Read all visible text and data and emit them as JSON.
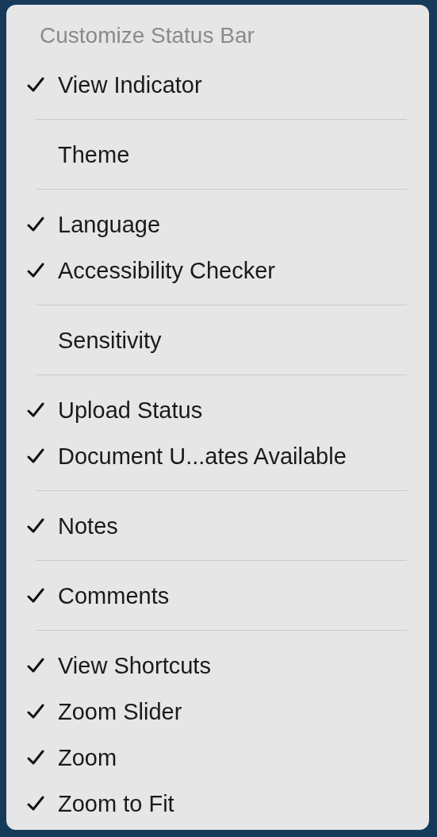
{
  "menu": {
    "title": "Customize Status Bar",
    "groups": [
      [
        {
          "label": "View Indicator",
          "checked": true
        }
      ],
      [
        {
          "label": "Theme",
          "checked": false
        }
      ],
      [
        {
          "label": "Language",
          "checked": true
        },
        {
          "label": "Accessibility Checker",
          "checked": true
        }
      ],
      [
        {
          "label": "Sensitivity",
          "checked": false
        }
      ],
      [
        {
          "label": "Upload Status",
          "checked": true
        },
        {
          "label": "Document U...ates Available",
          "checked": true
        }
      ],
      [
        {
          "label": "Notes",
          "checked": true
        }
      ],
      [
        {
          "label": "Comments",
          "checked": true
        }
      ],
      [
        {
          "label": "View Shortcuts",
          "checked": true
        },
        {
          "label": "Zoom Slider",
          "checked": true
        },
        {
          "label": "Zoom",
          "checked": true
        },
        {
          "label": "Zoom to Fit",
          "checked": true
        }
      ]
    ]
  }
}
